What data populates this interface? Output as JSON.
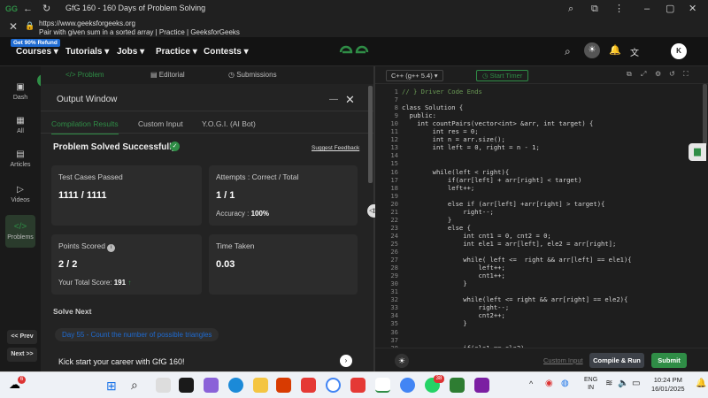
{
  "browser": {
    "tab_title": "GfG 160 - 160 Days of Problem Solving",
    "url": "https://www.geeksforgeeks.org",
    "page_title": "Pair with given sum in a sorted array | Practice | GeeksforGeeks"
  },
  "header": {
    "refund_badge": "Get 90% Refund",
    "nav": [
      "Courses",
      "Tutorials",
      "Jobs",
      "Practice",
      "Contests"
    ],
    "avatar_letter": "K"
  },
  "sidebar": {
    "items": [
      {
        "label": "Dash",
        "icon": "dashboard-icon"
      },
      {
        "label": "All",
        "icon": "grid-icon"
      },
      {
        "label": "Articles",
        "icon": "articles-icon"
      },
      {
        "label": "Videos",
        "icon": "video-icon"
      },
      {
        "label": "Problems",
        "icon": "code-icon"
      }
    ],
    "prev": "<< Prev",
    "next": "Next >>"
  },
  "problem_tabs": [
    "</> Problem",
    "Editorial",
    "Submissions"
  ],
  "output": {
    "title": "Output Window",
    "subtabs": [
      "Compilation Results",
      "Custom Input",
      "Y.O.G.I. (AI Bot)"
    ],
    "status": "Problem Solved Successfully",
    "suggest": "Suggest Feedback",
    "cards": {
      "test_cases_label": "Test Cases Passed",
      "test_cases_value": "1111 / 1111",
      "attempts_label": "Attempts : Correct / Total",
      "attempts_value": "1 / 1",
      "accuracy_label": "Accuracy :",
      "accuracy_value": "100%",
      "points_label": "Points Scored",
      "points_value": "2 / 2",
      "total_score_label": "Your Total Score:",
      "total_score_value": "191",
      "time_label": "Time Taken",
      "time_value": "0.03"
    },
    "solve_next_label": "Solve Next",
    "solve_next_link": "Day 55 - Count the number of possible triangles",
    "career_text": "Kick start your career with GfG 160!"
  },
  "editor": {
    "language": "C++ (g++ 5.4)",
    "timer": "Start Timer",
    "lines": [
      {
        "n": "1",
        "t": "// } Driver Code Ends"
      },
      {
        "n": "7",
        "t": ""
      },
      {
        "n": "8",
        "t": "class Solution {"
      },
      {
        "n": "9",
        "t": "  public:"
      },
      {
        "n": "10",
        "t": "    int countPairs(vector<int> &arr, int target) {"
      },
      {
        "n": "11",
        "t": "        int res = 0;"
      },
      {
        "n": "12",
        "t": "        int n = arr.size();"
      },
      {
        "n": "13",
        "t": "        int left = 0, right = n - 1;"
      },
      {
        "n": "14",
        "t": ""
      },
      {
        "n": "15",
        "t": ""
      },
      {
        "n": "16",
        "t": "        while(left < right){"
      },
      {
        "n": "17",
        "t": "            if(arr[left] + arr[right] < target)"
      },
      {
        "n": "18",
        "t": "            left++;"
      },
      {
        "n": "19",
        "t": ""
      },
      {
        "n": "20",
        "t": "            else if (arr[left] +arr[right] > target){"
      },
      {
        "n": "21",
        "t": "                right--;"
      },
      {
        "n": "22",
        "t": "            }"
      },
      {
        "n": "23",
        "t": "            else {"
      },
      {
        "n": "24",
        "t": "                int cnt1 = 0, cnt2 = 0;"
      },
      {
        "n": "25",
        "t": "                int ele1 = arr[left], ele2 = arr[right];"
      },
      {
        "n": "26",
        "t": ""
      },
      {
        "n": "27",
        "t": "                while( left <=  right && arr[left] == ele1){"
      },
      {
        "n": "28",
        "t": "                    left++;"
      },
      {
        "n": "29",
        "t": "                    cnt1++;"
      },
      {
        "n": "30",
        "t": "                }"
      },
      {
        "n": "31",
        "t": ""
      },
      {
        "n": "32",
        "t": "                while(left <= right && arr[right] == ele2){"
      },
      {
        "n": "33",
        "t": "                    right--;"
      },
      {
        "n": "34",
        "t": "                    cnt2++;"
      },
      {
        "n": "35",
        "t": "                }"
      },
      {
        "n": "36",
        "t": ""
      },
      {
        "n": "37",
        "t": ""
      },
      {
        "n": "38",
        "t": "                if(ele1 == ele2)"
      }
    ],
    "custom_input": "Custom Input",
    "compile_run": "Compile & Run",
    "submit": "Submit"
  },
  "taskbar": {
    "weather_badge": "6",
    "lang_top": "ENG",
    "lang_bottom": "IN",
    "time": "10:24 PM",
    "date": "16/01/2025",
    "badge_38": "38"
  },
  "colors": {
    "accent": "#2f8d46",
    "card": "#2c2c2c",
    "link_blue": "#1f6bd1"
  }
}
